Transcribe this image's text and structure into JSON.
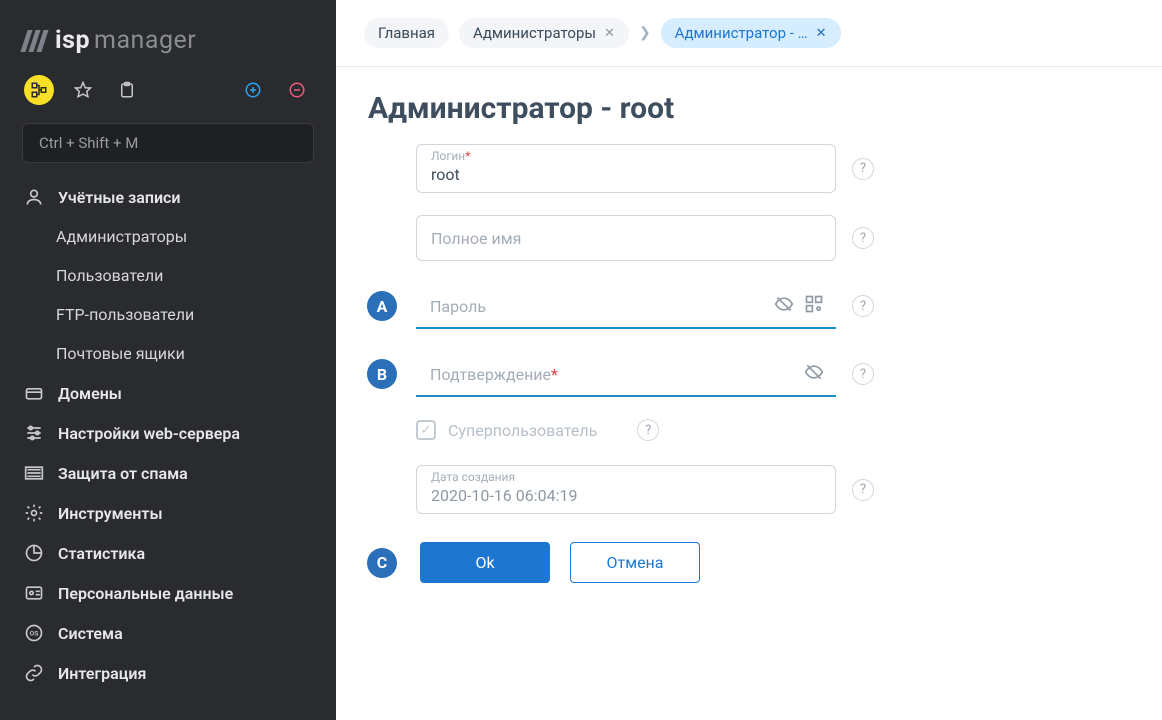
{
  "app": {
    "logo_bold": "isp",
    "logo_light": "manager"
  },
  "sidebar": {
    "search_placeholder": "Ctrl + Shift + M",
    "groups": [
      {
        "label": "Учётные записи",
        "items": [
          "Администраторы",
          "Пользователи",
          "FTP-пользователи",
          "Почтовые ящики"
        ]
      },
      {
        "label": "Домены"
      },
      {
        "label": "Настройки web-сервера"
      },
      {
        "label": "Защита от спама"
      },
      {
        "label": "Инструменты"
      },
      {
        "label": "Статистика"
      },
      {
        "label": "Персональные данные"
      },
      {
        "label": "Система"
      },
      {
        "label": "Интеграция"
      }
    ]
  },
  "breadcrumbs": {
    "home": "Главная",
    "admins": "Администраторы",
    "current": "Администратор - …"
  },
  "page": {
    "title": "Администратор - root",
    "markers": {
      "a": "A",
      "b": "B",
      "c": "C"
    },
    "fields": {
      "login_label": "Логин",
      "login_value": "root",
      "fullname_placeholder": "Полное имя",
      "password_placeholder": "Пароль",
      "confirm_placeholder": "Подтверждение",
      "superuser_label": "Суперпользователь",
      "created_label": "Дата создания",
      "created_value": "2020-10-16 06:04:19"
    },
    "actions": {
      "ok": "Ok",
      "cancel": "Отмена"
    }
  }
}
